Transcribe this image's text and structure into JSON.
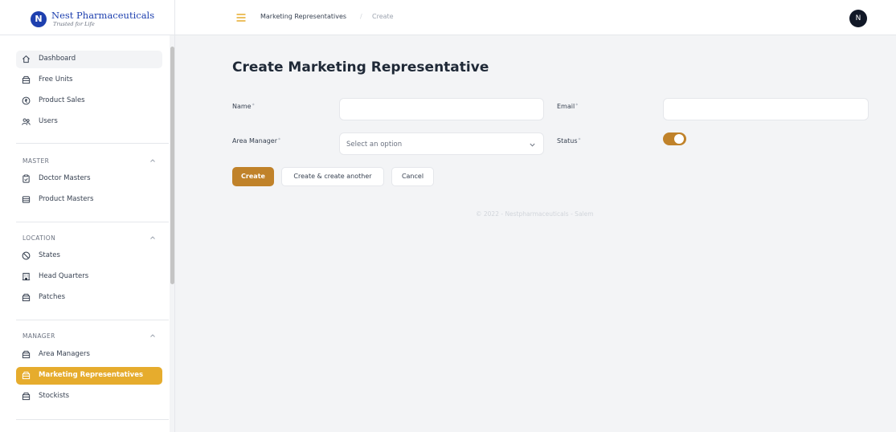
{
  "brand": {
    "name": "Nest Pharmaceuticals",
    "tagline": "Trusted for Life",
    "logo_letter": "N"
  },
  "sidebar": {
    "main_items": [
      {
        "label": "Dashboard",
        "icon": "home-icon"
      },
      {
        "label": "Free Units",
        "icon": "box-icon"
      },
      {
        "label": "Product Sales",
        "icon": "currency-icon"
      },
      {
        "label": "Users",
        "icon": "users-icon"
      }
    ],
    "groups": [
      {
        "title": "MASTER",
        "items": [
          {
            "label": "Doctor Masters",
            "icon": "clipboard-icon"
          },
          {
            "label": "Product Masters",
            "icon": "table-icon"
          }
        ]
      },
      {
        "title": "LOCATION",
        "items": [
          {
            "label": "States",
            "icon": "globe-icon"
          },
          {
            "label": "Head Quarters",
            "icon": "building-icon"
          },
          {
            "label": "Patches",
            "icon": "box-icon"
          }
        ]
      },
      {
        "title": "MANAGER",
        "items": [
          {
            "label": "Area Managers",
            "icon": "box-icon"
          },
          {
            "label": "Marketing Representatives",
            "icon": "box-icon",
            "active": true
          },
          {
            "label": "Stockists",
            "icon": "box-icon"
          }
        ]
      }
    ]
  },
  "topbar": {
    "breadcrumb": [
      "Marketing Representatives",
      "Create"
    ],
    "avatar_initial": "N"
  },
  "form": {
    "title": "Create Marketing Representative",
    "name_label": "Name",
    "email_label": "Email",
    "area_manager_label": "Area Manager",
    "status_label": "Status",
    "required_mark": "*",
    "name_value": "",
    "email_value": "",
    "area_manager_placeholder": "Select an option",
    "status_on": true
  },
  "buttons": {
    "create": "Create",
    "create_another": "Create & create another",
    "cancel": "Cancel"
  },
  "footer": {
    "text": "© 2022 - Nestpharmaceuticals - Salem"
  },
  "colors": {
    "accent": "#e6ac2d",
    "primary_button": "#c0822a",
    "brand_blue": "#1e40af"
  }
}
